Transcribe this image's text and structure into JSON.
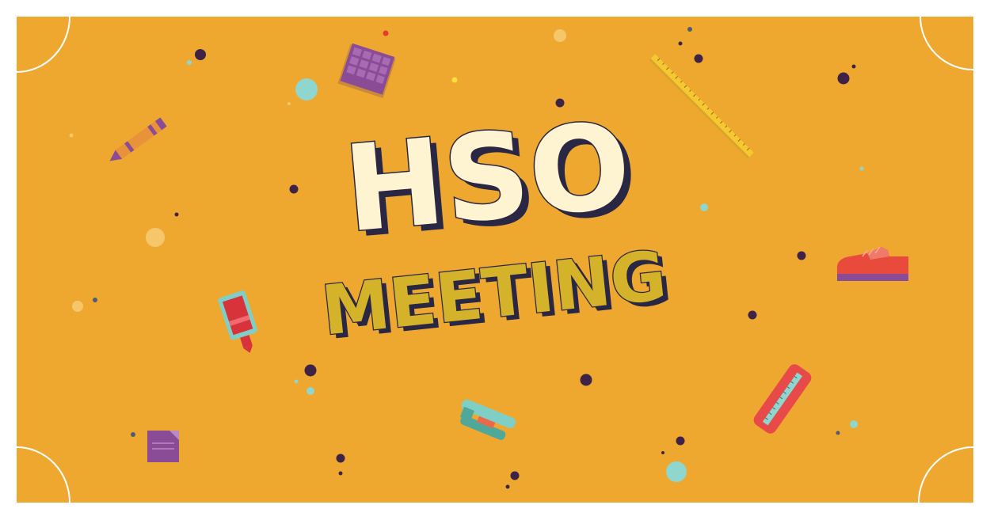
{
  "banner": {
    "title_line1": "HSO",
    "title_line2": "MEETING"
  },
  "colors": {
    "page_background": "#ffffff",
    "banner_background": "#EEA82F",
    "title_line1_fill": "#FFF4D1",
    "title_line2_fill": "#D4B229",
    "title_outline": "#2A2744",
    "corner_lines": "#ffffff",
    "dot_dark": "#3E2346",
    "dot_teal": "#8FD6CF",
    "dot_light": "#F6C76A",
    "dot_red": "#E63B2E",
    "dot_yellow": "#F8E03A",
    "dot_slate": "#4B5C74"
  },
  "decorations": [
    "grid-eraser-icon",
    "crayon-icon",
    "ruler-icon",
    "glue-stick-icon",
    "sneaker-icon",
    "stapler-icon",
    "sticky-note-icon",
    "pencil-case-icon"
  ]
}
